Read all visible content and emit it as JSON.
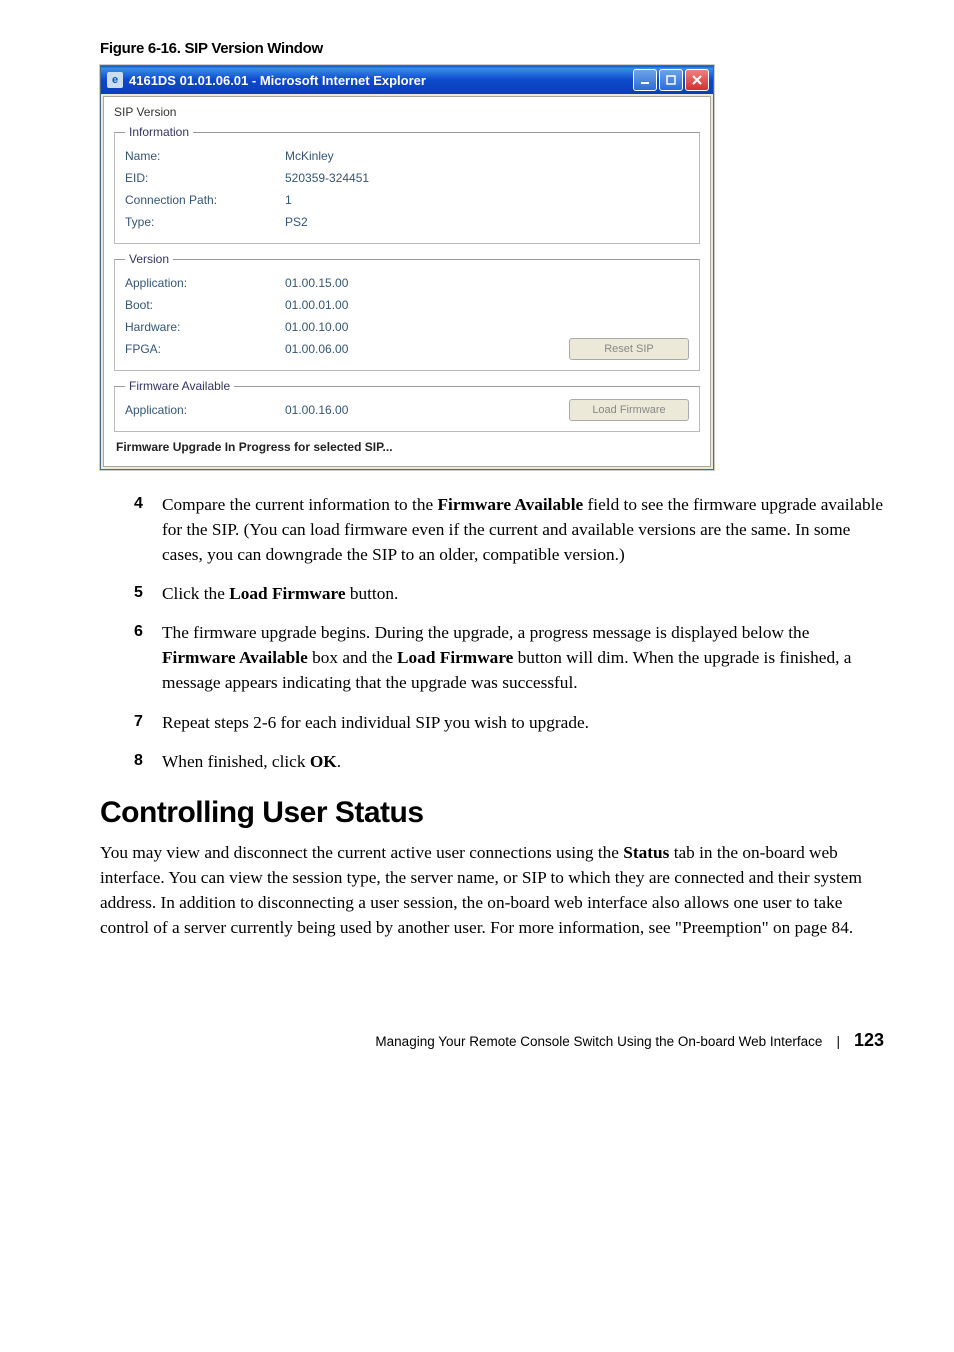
{
  "figure": {
    "caption": "Figure 6-16. SIP Version Window"
  },
  "window": {
    "title": "4161DS 01.01.06.01 - Microsoft Internet Explorer",
    "panel_title": "SIP Version",
    "information": {
      "legend": "Information",
      "name_label": "Name:",
      "name_value": "McKinley",
      "eid_label": "EID:",
      "eid_value": "520359-324451",
      "connpath_label": "Connection Path:",
      "connpath_value": "1",
      "type_label": "Type:",
      "type_value": "PS2"
    },
    "version": {
      "legend": "Version",
      "application_label": "Application:",
      "application_value": "01.00.15.00",
      "boot_label": "Boot:",
      "boot_value": "01.00.01.00",
      "hardware_label": "Hardware:",
      "hardware_value": "01.00.10.00",
      "fpga_label": "FPGA:",
      "fpga_value": "01.00.06.00",
      "reset_btn": "Reset SIP"
    },
    "firmware_available": {
      "legend": "Firmware Available",
      "application_label": "Application:",
      "application_value": "01.00.16.00",
      "load_btn": "Load Firmware"
    },
    "progress_msg": "Firmware Upgrade In Progress for selected SIP..."
  },
  "steps": {
    "s4": {
      "num": "4",
      "t1": "Compare the current information to the ",
      "b1": "Firmware Available",
      "t2": " field to see the firmware upgrade available for the SIP. (You can load firmware even if the current and available versions are the same. In some cases, you can downgrade the SIP to an older, compatible version.)"
    },
    "s5": {
      "num": "5",
      "t1": "Click the ",
      "b1": "Load Firmware",
      "t2": " button."
    },
    "s6": {
      "num": "6",
      "t1": "The firmware upgrade begins. During the upgrade, a progress message is displayed below the ",
      "b1": "Firmware Available",
      "t2": " box and the ",
      "b2": "Load Firmware",
      "t3": " button will dim. When the upgrade is finished, a message appears indicating that the upgrade was successful."
    },
    "s7": {
      "num": "7",
      "t1": "Repeat steps 2-6 for each individual SIP you wish to upgrade."
    },
    "s8": {
      "num": "8",
      "t1": "When finished, click ",
      "b1": "OK",
      "t2": "."
    }
  },
  "section_heading": "Controlling User Status",
  "section_body_1": "You may view and disconnect the current active user connections using the ",
  "section_body_b1": "Status",
  "section_body_2": " tab in the on-board web interface. You can view the session type, the server name, or SIP to which they are connected and their system address. In addition to disconnecting a user session, the on-board web interface also allows one user to take control of a server currently being used by another user. For more information, see \"Preemption\" on page 84.",
  "footer": {
    "text": "Managing Your Remote Console Switch Using the On-board Web Interface",
    "sep": "|",
    "page": "123"
  }
}
